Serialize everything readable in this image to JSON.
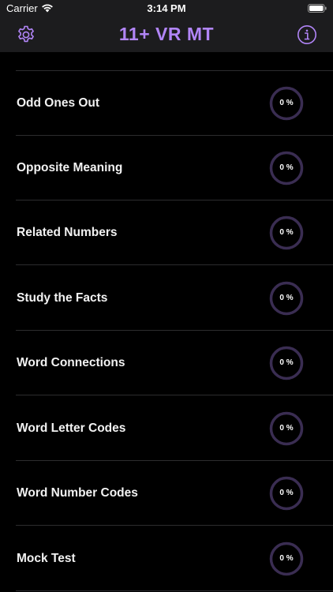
{
  "status_bar": {
    "carrier": "Carrier",
    "time": "3:14 PM"
  },
  "nav": {
    "title": "11+ VR MT",
    "left_icon": "gear-icon",
    "right_icon": "info-icon"
  },
  "colors": {
    "accent": "#b185f7",
    "ring": "#3a2d52",
    "background": "#000000",
    "header": "#1c1c1e"
  },
  "topics": [
    {
      "label": "Odd Ones Out",
      "progress_text": "0 %",
      "progress": 0
    },
    {
      "label": "Opposite Meaning",
      "progress_text": "0 %",
      "progress": 0
    },
    {
      "label": "Related Numbers",
      "progress_text": "0 %",
      "progress": 0
    },
    {
      "label": "Study the Facts",
      "progress_text": "0 %",
      "progress": 0
    },
    {
      "label": "Word Connections",
      "progress_text": "0 %",
      "progress": 0
    },
    {
      "label": "Word Letter Codes",
      "progress_text": "0 %",
      "progress": 0
    },
    {
      "label": "Word Number Codes",
      "progress_text": "0 %",
      "progress": 0
    },
    {
      "label": "Mock Test",
      "progress_text": "0 %",
      "progress": 0
    }
  ]
}
